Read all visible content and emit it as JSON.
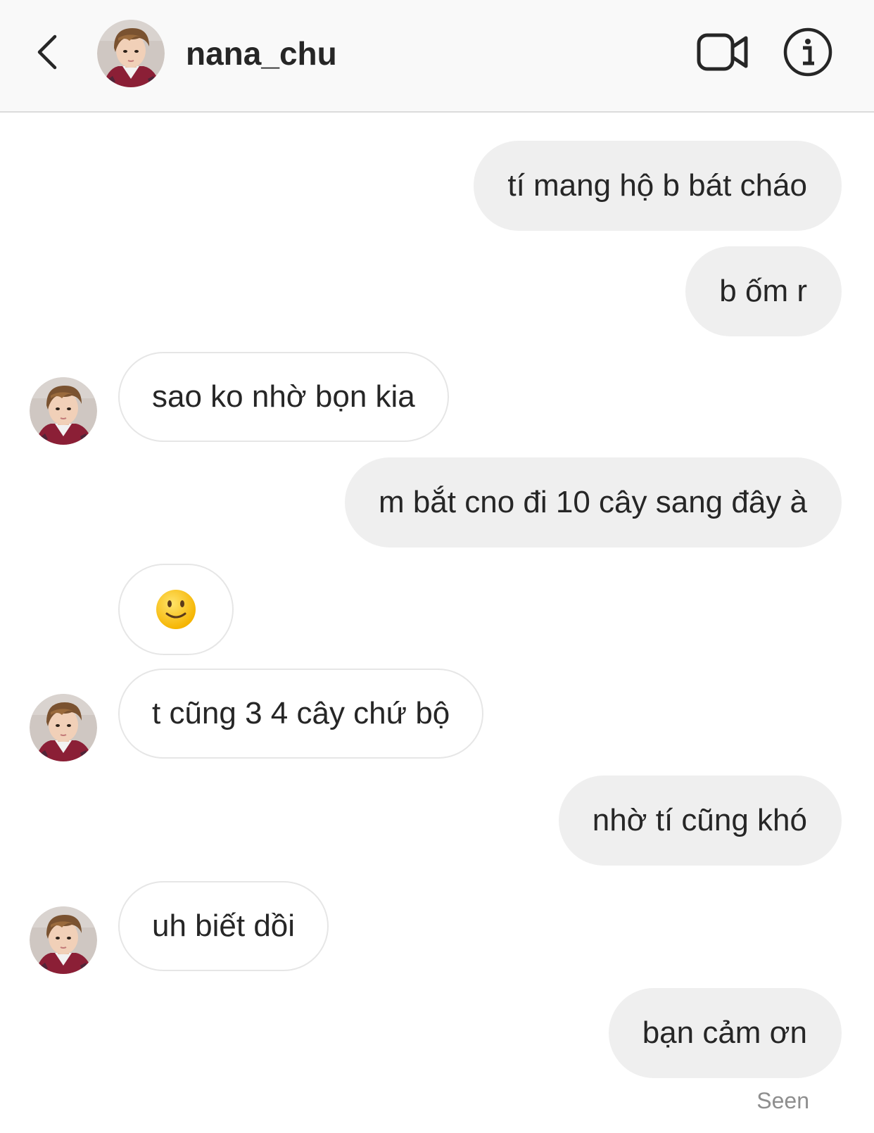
{
  "header": {
    "username": "nana_chu",
    "back_icon": "chevron-left-icon",
    "video_icon": "video-camera-icon",
    "info_icon": "info-icon"
  },
  "messages": [
    {
      "from": "me",
      "text": "tí mang hộ b bát cháo"
    },
    {
      "from": "me",
      "text": "b ốm r"
    },
    {
      "from": "them",
      "text": "sao ko nhờ bọn kia"
    },
    {
      "from": "me",
      "text": "m bắt cno đi 10 cây sang đây à"
    },
    {
      "from": "them",
      "type": "emoji",
      "emoji": "slightly-smiling-face"
    },
    {
      "from": "them",
      "text": "t cũng 3 4 cây chứ bộ"
    },
    {
      "from": "me",
      "text": "nhờ tí cũng khó"
    },
    {
      "from": "them",
      "text": "uh biết dồi"
    },
    {
      "from": "me",
      "text": "bạn cảm ơn"
    }
  ],
  "status": {
    "seen": "Seen"
  },
  "colors": {
    "sent_bubble": "#efefef",
    "recv_border": "#e6e6e6",
    "header_bg": "#f9f9f9",
    "seen_text": "#8e8e8e"
  }
}
